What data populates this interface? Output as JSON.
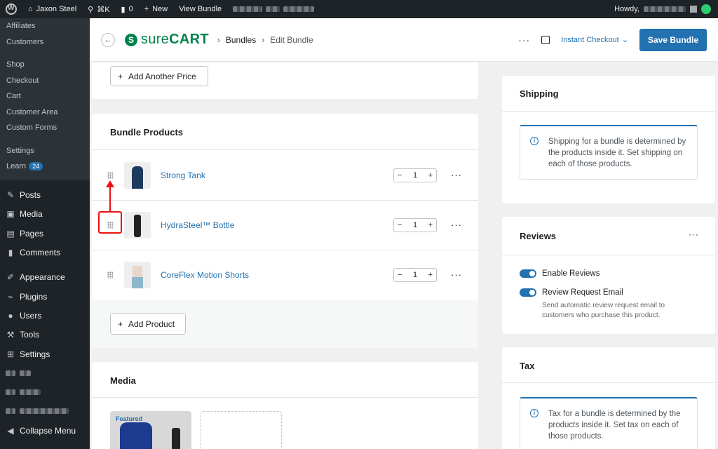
{
  "adminbar": {
    "site_name": "Jaxon Steel",
    "search_shortcut": "⌘K",
    "comments_count": "0",
    "new_label": "New",
    "view_label": "View Bundle",
    "howdy": "Howdy,"
  },
  "sidebar": {
    "sub_items_top": [
      "Affiliates",
      "Customers"
    ],
    "sub_items_shop": [
      "Shop",
      "Checkout",
      "Cart",
      "Customer Area",
      "Custom Forms"
    ],
    "sub_items_settings": [
      "Settings"
    ],
    "learn_label": "Learn",
    "learn_badge": "24",
    "menu": [
      {
        "label": "Posts",
        "icon": "pin-icon"
      },
      {
        "label": "Media",
        "icon": "media-icon"
      },
      {
        "label": "Pages",
        "icon": "pages-icon"
      },
      {
        "label": "Comments",
        "icon": "comment-icon"
      },
      {
        "label": "Appearance",
        "icon": "brush-icon"
      },
      {
        "label": "Plugins",
        "icon": "plugin-icon"
      },
      {
        "label": "Users",
        "icon": "user-icon"
      },
      {
        "label": "Tools",
        "icon": "wrench-icon"
      },
      {
        "label": "Settings",
        "icon": "settings-icon"
      }
    ],
    "collapse_label": "Collapse Menu"
  },
  "header": {
    "logo_text_1": "sure",
    "logo_text_2": "CART",
    "breadcrumb_1": "Bundles",
    "breadcrumb_2": "Edit Bundle",
    "checkout_link": "Instant Checkout",
    "save_label": "Save Bundle"
  },
  "pricing": {
    "add_price_label": "Add Another Price"
  },
  "bundle_products": {
    "title": "Bundle Products",
    "items": [
      {
        "name": "Strong Tank",
        "qty": "1"
      },
      {
        "name": "HydraSteel™ Bottle",
        "qty": "1"
      },
      {
        "name": "CoreFlex Motion Shorts",
        "qty": "1"
      }
    ],
    "add_product_label": "Add Product"
  },
  "media": {
    "title": "Media",
    "featured_tag": "Featured"
  },
  "shipping": {
    "title": "Shipping",
    "info": "Shipping for a bundle is determined by the products inside it. Set shipping on each of those products."
  },
  "reviews": {
    "title": "Reviews",
    "enable_label": "Enable Reviews",
    "request_label": "Review Request Email",
    "request_help": "Send automatic review request email to customers who purchase this product."
  },
  "tax": {
    "title": "Tax",
    "info": "Tax for a bundle is determined by the products inside it. Set tax on each of those products."
  },
  "colors": {
    "accent": "#2271b1",
    "brand": "#01824c",
    "admin_dark": "#1d2327",
    "annotation": "#e11111"
  }
}
